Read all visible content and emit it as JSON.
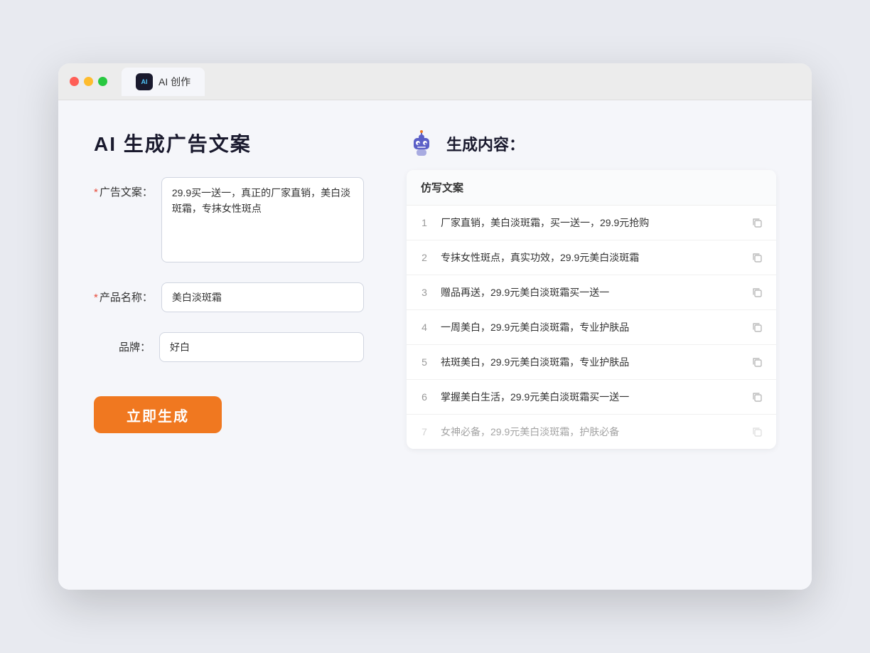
{
  "browser": {
    "tab_label": "AI 创作",
    "tab_icon": "ai-logo"
  },
  "page": {
    "title": "AI 生成广告文案",
    "right_title": "生成内容："
  },
  "form": {
    "ad_copy_label": "广告文案：",
    "ad_copy_required": "*",
    "ad_copy_value": "29.9买一送一，真正的厂家直销，美白淡斑霜，专抹女性斑点",
    "product_name_label": "产品名称：",
    "product_name_required": "*",
    "product_name_value": "美白淡斑霜",
    "brand_label": "品牌：",
    "brand_value": "好白",
    "generate_btn_label": "立即生成"
  },
  "results": {
    "column_header": "仿写文案",
    "items": [
      {
        "num": 1,
        "text": "厂家直销，美白淡斑霜，买一送一，29.9元抢购",
        "faded": false
      },
      {
        "num": 2,
        "text": "专抹女性斑点，真实功效，29.9元美白淡斑霜",
        "faded": false
      },
      {
        "num": 3,
        "text": "赠品再送，29.9元美白淡斑霜买一送一",
        "faded": false
      },
      {
        "num": 4,
        "text": "一周美白，29.9元美白淡斑霜，专业护肤品",
        "faded": false
      },
      {
        "num": 5,
        "text": "祛斑美白，29.9元美白淡斑霜，专业护肤品",
        "faded": false
      },
      {
        "num": 6,
        "text": "掌握美白生活，29.9元美白淡斑霜买一送一",
        "faded": false
      },
      {
        "num": 7,
        "text": "女神必备，29.9元美白淡斑霜，护肤必备",
        "faded": true
      }
    ]
  }
}
